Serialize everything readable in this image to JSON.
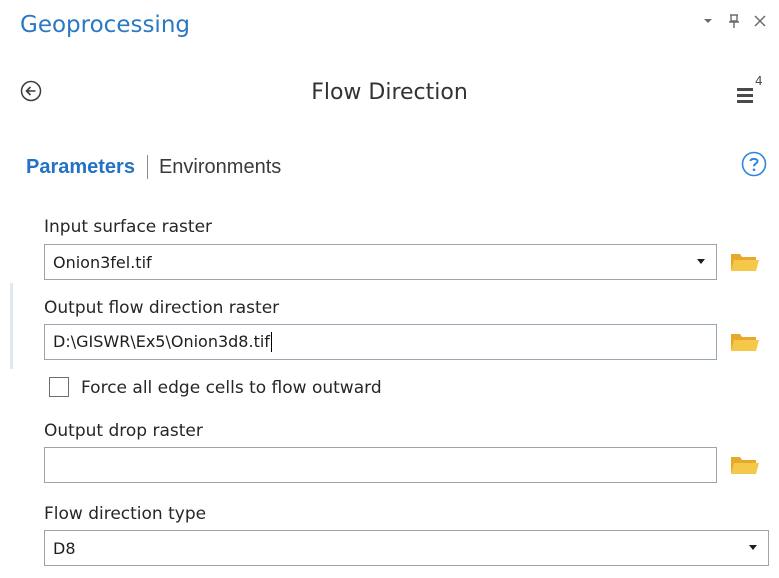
{
  "pane": {
    "title": "Geoprocessing",
    "controls": {
      "options_icon": "chevron-down-icon",
      "pin_icon": "pin-icon",
      "close_icon": "close-icon"
    }
  },
  "tool": {
    "title": "Flow Direction",
    "back_icon": "back-arrow-icon",
    "menu_icon": "hamburger-menu-icon",
    "menu_badge": "4"
  },
  "tabs": {
    "active": "Parameters",
    "items": [
      {
        "label": "Parameters"
      },
      {
        "label": "Environments"
      }
    ],
    "help_icon": "help-icon"
  },
  "parameters": {
    "input_surface_raster": {
      "label": "Input surface raster",
      "value": "Onion3fel.tif"
    },
    "output_flow_direction_raster": {
      "label": "Output flow direction raster",
      "value": "D:\\GISWR\\Ex5\\Onion3d8.tif"
    },
    "force_edge": {
      "label": "Force all edge cells to flow outward",
      "checked": false
    },
    "output_drop_raster": {
      "label": "Output drop raster",
      "value": ""
    },
    "flow_direction_type": {
      "label": "Flow direction type",
      "value": "D8"
    }
  },
  "colors": {
    "accent": "#2b79c2",
    "active_tab": "#2372c4",
    "folder": "#f1c03b",
    "help": "#2d86dc"
  }
}
